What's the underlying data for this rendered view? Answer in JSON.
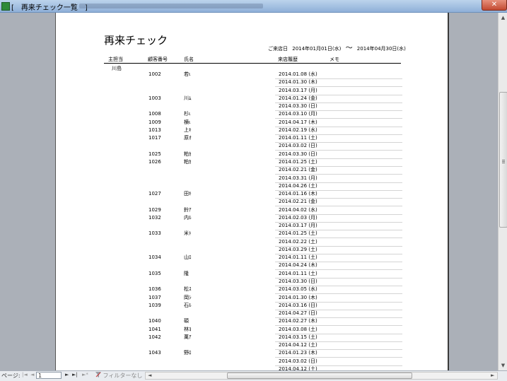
{
  "window": {
    "title": "[　再来チェック一覧　]"
  },
  "report": {
    "title": "再来チェック",
    "date_range_label": "ご来店日",
    "date_from": "2014年01月01日(水)",
    "tilde": "～",
    "date_to": "2014年04月30日(水)"
  },
  "columns": {
    "staff": "主担当",
    "customer_no": "顧客番号",
    "name": "氏名",
    "visits": "来店履歴",
    "memo": "メモ"
  },
  "staff_name": "川島",
  "rows": [
    {
      "no": "1002",
      "name": "若ι",
      "visits": [
        "2014.01.08 (水)",
        "2014.01.30 (木)",
        "2014.03.17 (月)"
      ]
    },
    {
      "no": "1003",
      "name": "川ﾑ",
      "visits": [
        "2014.01.24 (金)",
        "2014.03.30 (日)"
      ]
    },
    {
      "no": "1008",
      "name": "杉ι",
      "visits": [
        "2014.03.10 (月)"
      ]
    },
    {
      "no": "1009",
      "name": "横ι",
      "visits": [
        "2014.04.17 (木)"
      ]
    },
    {
      "no": "1013",
      "name": "上ｷ",
      "visits": [
        "2014.02.19 (水)"
      ]
    },
    {
      "no": "1017",
      "name": "原ｵ",
      "visits": [
        "2014.01.11 (土)",
        "2014.03.02 (日)"
      ]
    },
    {
      "no": "1025",
      "name": "粕ｶ",
      "visits": [
        "2014.03.30 (日)"
      ]
    },
    {
      "no": "1026",
      "name": "粕ｶ",
      "visits": [
        "2014.01.25 (土)",
        "2014.02.21 (金)",
        "2014.03.31 (月)",
        "2014.04.26 (土)"
      ]
    },
    {
      "no": "1027",
      "name": "田ｷ",
      "visits": [
        "2014.01.16 (木)",
        "2014.02.21 (金)"
      ]
    },
    {
      "no": "1029",
      "name": "鈴ｱ",
      "visits": [
        "2014.04.02 (水)"
      ]
    },
    {
      "no": "1032",
      "name": "内ﾙ",
      "visits": [
        "2014.02.03 (月)",
        "2014.03.17 (月)"
      ]
    },
    {
      "no": "1033",
      "name": "米ﾄ",
      "visits": [
        "2014.01.25 (土)",
        "2014.02.22 (土)",
        "2014.03.29 (土)"
      ]
    },
    {
      "no": "1034",
      "name": "山ﾛ",
      "visits": [
        "2014.01.11 (土)",
        "2014.04.24 (木)"
      ]
    },
    {
      "no": "1035",
      "name": "隆",
      "visits": [
        "2014.01.11 (土)",
        "2014.03.30 (日)"
      ]
    },
    {
      "no": "1036",
      "name": "松ｽ",
      "visits": [
        "2014.03.05 (水)"
      ]
    },
    {
      "no": "1037",
      "name": "岡ｼ",
      "visits": [
        "2014.01.30 (木)"
      ]
    },
    {
      "no": "1039",
      "name": "石ﾙ",
      "visits": [
        "2014.03.16 (日)",
        "2014.04.27 (日)"
      ]
    },
    {
      "no": "1040",
      "name": "碩",
      "visits": [
        "2014.02.27 (木)"
      ]
    },
    {
      "no": "1041",
      "name": "林ﾖ",
      "visits": [
        "2014.03.08 (土)"
      ]
    },
    {
      "no": "1042",
      "name": "萬ｱ",
      "visits": [
        "2014.03.15 (土)",
        "2014.04.12 (土)"
      ]
    },
    {
      "no": "1043",
      "name": "野ﾛ",
      "visits": [
        "2014.01.23 (木)",
        "2014.03.02 (日)",
        "2014.04.12 (土)"
      ]
    }
  ],
  "navbar": {
    "page_label": "ページ:",
    "first": "|◄",
    "prev": "◄",
    "current_page": "1",
    "next": "►",
    "last": "►|",
    "new": "►*",
    "filter_label": "フィルターなし"
  },
  "colors": {
    "titlebar": "#8fb0d8",
    "close": "#c24a32"
  },
  "icons": {
    "app": "access-report-icon",
    "filter": "filter-icon",
    "close": "close-icon"
  }
}
